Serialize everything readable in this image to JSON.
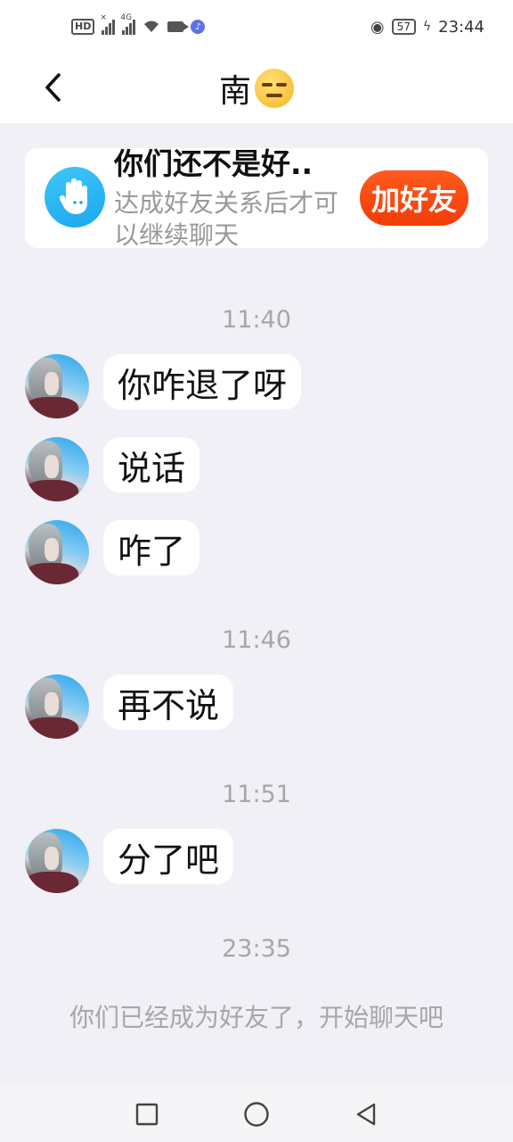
{
  "status_bar": {
    "hd_label": "HD",
    "network_label": "4G",
    "battery": "57",
    "time": "23:44"
  },
  "header": {
    "title": "南",
    "back_icon": "chevron-left-icon",
    "title_emoji": "expressionless-face-emoji"
  },
  "friend_card": {
    "title": "你们还不是好..",
    "description": "达成好友关系后才可以继续聊天",
    "button_label": "加好友",
    "icon": "hand-icon"
  },
  "messages": [
    {
      "time": "11:40"
    },
    {
      "text": "你咋退了呀"
    },
    {
      "text": "说话"
    },
    {
      "text": "咋了"
    },
    {
      "time": "11:46"
    },
    {
      "text": "再不说"
    },
    {
      "time": "11:51"
    },
    {
      "text": "分了吧"
    },
    {
      "time": "23:35"
    }
  ],
  "system_message": "你们已经成为好友了，开始聊天吧",
  "nav_bar": {
    "recents_icon": "square-icon",
    "home_icon": "circle-icon",
    "back_icon": "triangle-back-icon"
  },
  "colors": {
    "accent_orange": "#f4470f",
    "card_icon_blue": "#1aa7ef",
    "background": "#f0f0f6"
  }
}
